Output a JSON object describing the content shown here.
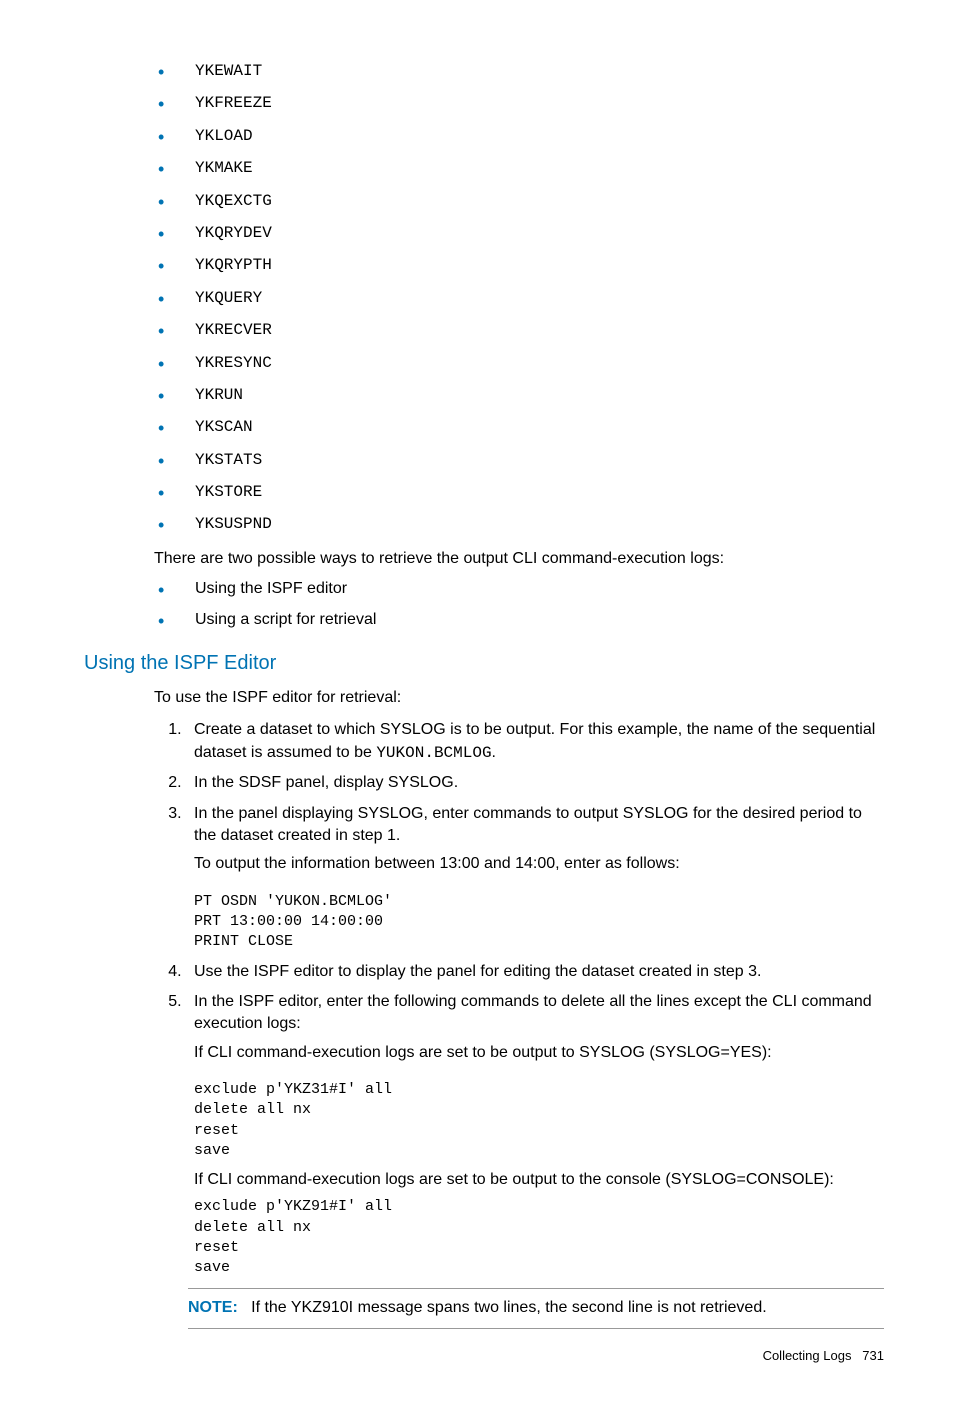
{
  "commands": [
    "YKEWAIT",
    "YKFREEZE",
    "YKLOAD",
    "YKMAKE",
    "YKQEXCTG",
    "YKQRYDEV",
    "YKQRYPTH",
    "YKQUERY",
    "YKRECVER",
    "YKRESYNC",
    "YKRUN",
    "YKSCAN",
    "YKSTATS",
    "YKSTORE",
    "YKSUSPND"
  ],
  "intro_ways": "There are two possible ways to retrieve the output CLI command-execution logs:",
  "ways": [
    "Using the ISPF editor",
    "Using a script for retrieval"
  ],
  "section_heading": "Using the ISPF Editor",
  "intro_use": "To use the ISPF editor for retrieval:",
  "step1_a": "Create a dataset to which SYSLOG is to be output. For this example, the name of the sequential dataset is assumed to be ",
  "step1_code": "YUKON.BCMLOG",
  "step1_b": ".",
  "step2": "In the SDSF panel, display SYSLOG.",
  "step3_a": "In the panel displaying SYSLOG, enter commands to output SYSLOG for the desired period to the dataset created in step 1.",
  "step3_b": "To output the information between 13:00 and 14:00, enter as follows:",
  "code1": "PT OSDN 'YUKON.BCMLOG'\nPRT 13:00:00 14:00:00\nPRINT CLOSE",
  "step4": "Use the ISPF editor to display the panel for editing the dataset created in step 3.",
  "step5_a": "In the ISPF editor, enter the following commands to delete all the lines except the CLI command execution logs:",
  "step5_b": "If CLI command-execution logs are set to be output to SYSLOG (SYSLOG=YES):",
  "code2": "exclude p'YKZ31#I' all\ndelete all nx\nreset\nsave",
  "step5_c": "If CLI command-execution logs are set to be output to the console (SYSLOG=CONSOLE):",
  "code3": "exclude p'YKZ91#I' all\ndelete all nx\nreset\nsave",
  "note_label": "NOTE:",
  "note_text": "If the YKZ910I message spans two lines, the second line is not retrieved.",
  "footer_label": "Collecting Logs",
  "footer_page": "731"
}
